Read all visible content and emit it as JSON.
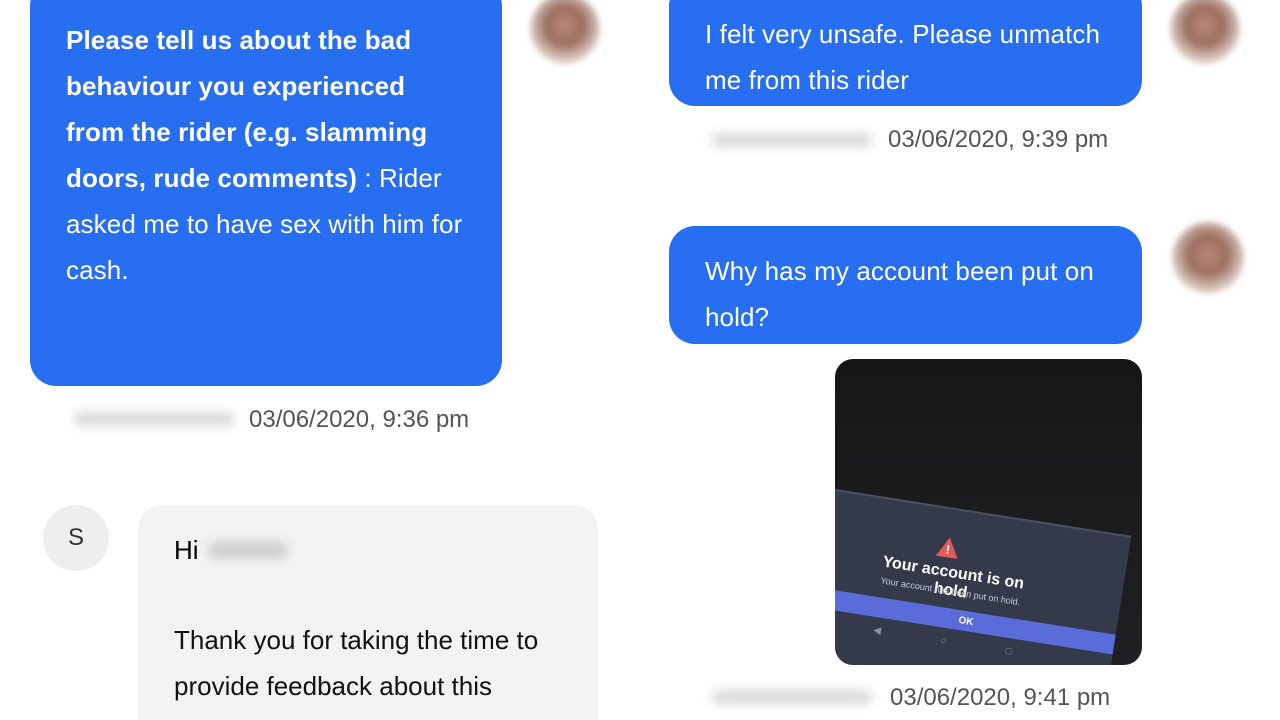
{
  "left": {
    "report_message": {
      "question": "Please tell us about the bad behaviour you experienced from the rider (e.g. slamming doors, rude comments)",
      "separator": " : ",
      "answer": "Rider asked me to have sex with him for cash."
    },
    "report_timestamp": "03/06/2020, 9:36 pm",
    "system_reply": {
      "avatar_letter": "S",
      "greeting": "Hi",
      "body": "Thank you for taking the time to provide feedback about this"
    }
  },
  "right": {
    "message_unsafe": "I felt very unsafe. Please unmatch me from this rider",
    "timestamp_unsafe": "03/06/2020, 9:39 pm",
    "message_hold": "Why has my account been put on hold?",
    "screenshot": {
      "title": "Your account is on hold",
      "subtitle": "Your account has been put on hold.",
      "ok": "OK",
      "warning_icon": "warning-triangle-icon"
    },
    "timestamp_screenshot": "03/06/2020, 9:41 pm"
  },
  "colors": {
    "bubble_blue": "#276ef1",
    "incoming_bubble": "#f3f3f3",
    "timestamp_text": "#545454",
    "warning_red": "#e15b5b",
    "ok_button": "#5a6cd8"
  }
}
